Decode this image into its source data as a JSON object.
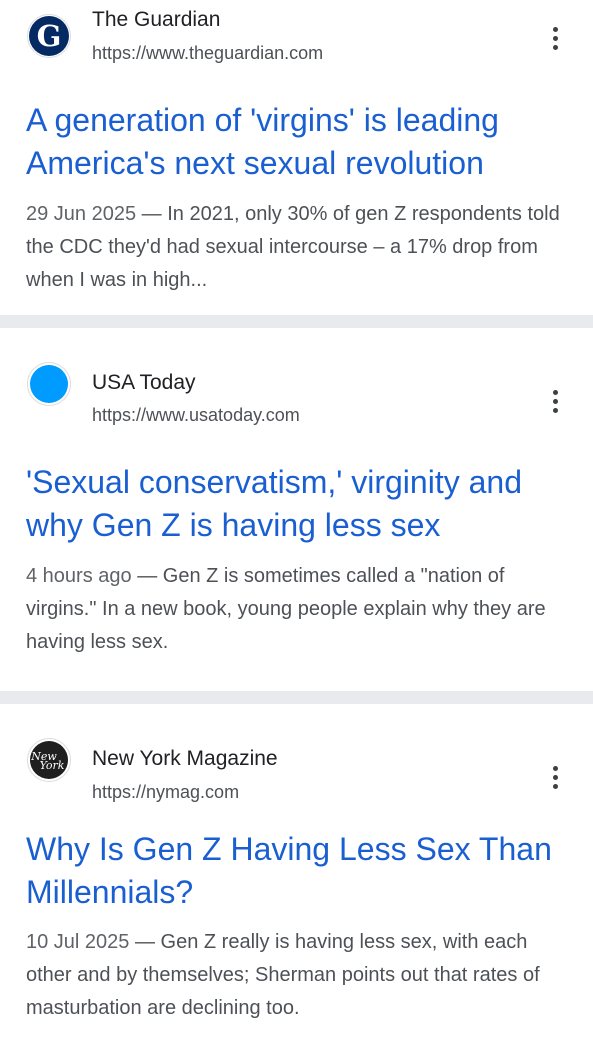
{
  "results": [
    {
      "site_name": "The Guardian",
      "url": "https://www.theguardian.com",
      "favicon": "guardian-logo-icon",
      "title": "A generation of 'virgins' is leading America's next sexual revolution",
      "date": "29 Jun 2025",
      "separator": " — ",
      "snippet": "In 2021, only 30% of gen Z respondents told the CDC they'd had sexual intercourse – a 17% drop from when I was in high..."
    },
    {
      "site_name": "USA Today",
      "url": "https://www.usatoday.com",
      "favicon": "usa-today-logo-icon",
      "title": "'Sexual conservatism,' virginity and why Gen Z is having less sex",
      "date": "4 hours ago",
      "separator": " — ",
      "snippet": "Gen Z is sometimes called a \"nation of virgins.\" In a new book, young people explain why they are having less sex."
    },
    {
      "site_name": "New York Magazine",
      "url": "https://nymag.com",
      "favicon": "new-york-magazine-logo-icon",
      "title": "Why Is Gen Z Having Less Sex Than Millennials?",
      "date": "10 Jul 2025",
      "separator": " — ",
      "snippet": "Gen Z really is having less sex, with each other and by themselves; Sherman points out that rates of masturbation are declining too."
    }
  ],
  "colors": {
    "title_link": "#1a5fd1",
    "divider": "#e8eaed",
    "usa_today_blue": "#009bff",
    "guardian_navy": "#052962"
  }
}
